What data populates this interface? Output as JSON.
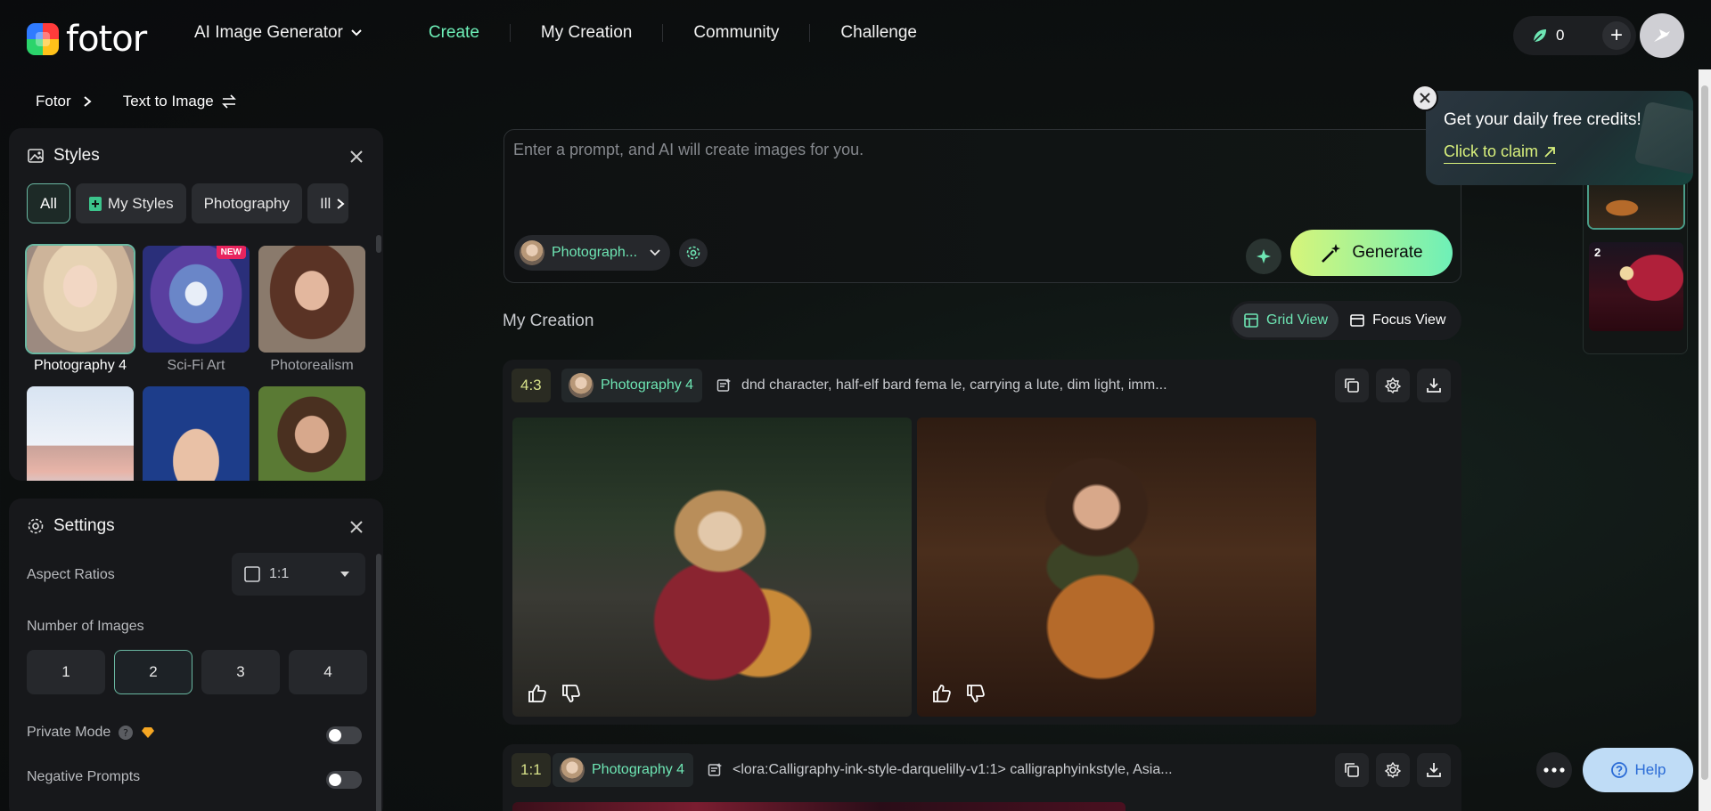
{
  "app": {
    "logo_text": "fotor"
  },
  "topnav": {
    "tool": "AI Image Generator",
    "items": [
      {
        "label": "Create",
        "active": true
      },
      {
        "label": "My Creation"
      },
      {
        "label": "Community"
      },
      {
        "label": "Challenge"
      }
    ],
    "credits": "0",
    "add_credits_label": "+"
  },
  "breadcrumb": {
    "root": "Fotor",
    "current": "Text to Image"
  },
  "styles_panel": {
    "title": "Styles",
    "chips": [
      "All",
      "My Styles",
      "Photography",
      "Ill"
    ],
    "selected_chip": "All",
    "new_badge": "NEW",
    "cards": [
      {
        "label": "Photography 4",
        "selected": true,
        "new": false
      },
      {
        "label": "Sci-Fi Art",
        "selected": false,
        "new": true
      },
      {
        "label": "Photorealism",
        "selected": false,
        "new": false
      },
      {
        "label": "",
        "selected": false,
        "new": false
      },
      {
        "label": "",
        "selected": false,
        "new": false
      },
      {
        "label": "",
        "selected": false,
        "new": false
      }
    ]
  },
  "settings_panel": {
    "title": "Settings",
    "aspect_ratios_label": "Aspect Ratios",
    "aspect_ratio_value": "1:1",
    "number_of_images_label": "Number of Images",
    "number_options": [
      "1",
      "2",
      "3",
      "4"
    ],
    "number_selected": "2",
    "private_mode_label": "Private Mode",
    "private_mode_on": false,
    "negative_prompts_label": "Negative Prompts",
    "negative_prompts_on": false
  },
  "prompt": {
    "placeholder": "Enter a prompt, and AI will create images for you.",
    "style_pill": "Photograph...",
    "generate_label": "Generate"
  },
  "my_creation": {
    "title": "My Creation",
    "grid_view_label": "Grid View",
    "focus_view_label": "Focus View",
    "active_view": "Grid View",
    "cards": [
      {
        "ratio": "4:3",
        "style": "Photography 4",
        "prompt": "dnd character, half-elf bard fema le, carrying a lute, dim light, imm..."
      },
      {
        "ratio": "1:1",
        "style": "Photography 4",
        "prompt": "<lora:Calligraphy-ink-style-darquelilly-v1:1> calligraphyinkstyle, Asia..."
      }
    ]
  },
  "history_strip": {
    "items": [
      "",
      "2"
    ]
  },
  "promo": {
    "title": "Get your daily free credits!",
    "link": "Click to claim"
  },
  "help": {
    "label": "Help"
  },
  "colors": {
    "accent": "#6ee6b4",
    "generate_start": "#d6f57a",
    "generate_end": "#6ef0b8",
    "new_badge": "#e8245e"
  }
}
